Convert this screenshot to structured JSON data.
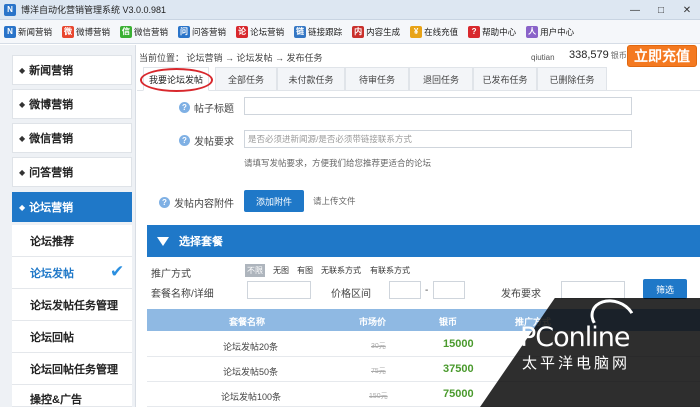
{
  "window": {
    "title": "博洋自动化营销管理系统 V3.0.0.981",
    "logo_letter": "N",
    "min": "—",
    "max": "□",
    "close": "✕"
  },
  "toolbar": [
    {
      "label": "新闻营销",
      "icon": "news-icon",
      "color": "#2a74c9",
      "glyph": "N"
    },
    {
      "label": "微博营销",
      "icon": "weibo-icon",
      "color": "#e8462e",
      "glyph": "微"
    },
    {
      "label": "微信营销",
      "icon": "wechat-icon",
      "color": "#3bb034",
      "glyph": "信"
    },
    {
      "label": "问答营销",
      "icon": "qa-icon",
      "color": "#2a74c9",
      "glyph": "问"
    },
    {
      "label": "论坛营销",
      "icon": "forum-icon",
      "color": "#d8282d",
      "glyph": "论"
    },
    {
      "label": "链接跟踪",
      "icon": "link-icon",
      "color": "#3577c4",
      "glyph": "链"
    },
    {
      "label": "内容生成",
      "icon": "content-icon",
      "color": "#c9302c",
      "glyph": "内"
    },
    {
      "label": "在线充值",
      "icon": "recharge-icon",
      "color": "#e8a317",
      "glyph": "¥"
    },
    {
      "label": "帮助中心",
      "icon": "help-icon",
      "color": "#d8282d",
      "glyph": "?"
    },
    {
      "label": "用户中心",
      "icon": "user-icon",
      "color": "#8a63c9",
      "glyph": "人"
    }
  ],
  "sidebar": {
    "categories": [
      {
        "label": "新闻营销"
      },
      {
        "label": "微博营销"
      },
      {
        "label": "微信营销"
      },
      {
        "label": "问答营销"
      },
      {
        "label": "论坛营销"
      }
    ],
    "sub_items": [
      {
        "label": "论坛推荐"
      },
      {
        "label": "论坛发帖"
      },
      {
        "label": "论坛发帖任务管理"
      },
      {
        "label": "论坛回帖"
      },
      {
        "label": "论坛回帖任务管理"
      },
      {
        "label": "操控&广告"
      }
    ],
    "dot": "◆",
    "check": "✔"
  },
  "header": {
    "breadcrumb": "当前位置： 论坛营销 → 论坛发帖 → 发布任务",
    "username": "qiutian",
    "balance": "338,579",
    "balance_unit": "银币",
    "recharge_label": "立即充值"
  },
  "tabs": [
    {
      "label": "我要论坛发帖"
    },
    {
      "label": "全部任务"
    },
    {
      "label": "未付款任务"
    },
    {
      "label": "待审任务"
    },
    {
      "label": "退回任务"
    },
    {
      "label": "已发布任务"
    },
    {
      "label": "已删除任务"
    }
  ],
  "form": {
    "q_glyph": "?",
    "title_label": "帖子标题",
    "title_value": "",
    "req_label": "发帖要求",
    "req_placeholder": "是否必须进新闻源/是否必须带链接联系方式",
    "req_hint": "请填写发帖要求，方便我们给您推荐更适合的论坛",
    "attach_label": "发帖内容附件",
    "attach_button": "添加附件",
    "attach_hint": "请上传文件"
  },
  "packages": {
    "header": "选择套餐",
    "promo_label": "推广方式",
    "promo_options": [
      {
        "label": "不限"
      },
      {
        "label": "无图"
      },
      {
        "label": "有图"
      },
      {
        "label": "无联系方式"
      },
      {
        "label": "有联系方式"
      }
    ],
    "name_label": "套餐名称/详细",
    "price_label": "价格区间",
    "price_sep": "-",
    "publish_label": "发布要求",
    "filter_button": "筛选",
    "columns": [
      "套餐名称",
      "市场价",
      "银币",
      "推广方式"
    ],
    "rows": [
      {
        "name": "论坛发帖20条",
        "market": "30元",
        "coins": "15000"
      },
      {
        "name": "论坛发帖50条",
        "market": "75元",
        "coins": "37500"
      },
      {
        "name": "论坛发帖100条",
        "market": "150元",
        "coins": "75000"
      }
    ]
  },
  "watermark": {
    "brand": "PConline",
    "sub": "太平洋电脑网"
  }
}
